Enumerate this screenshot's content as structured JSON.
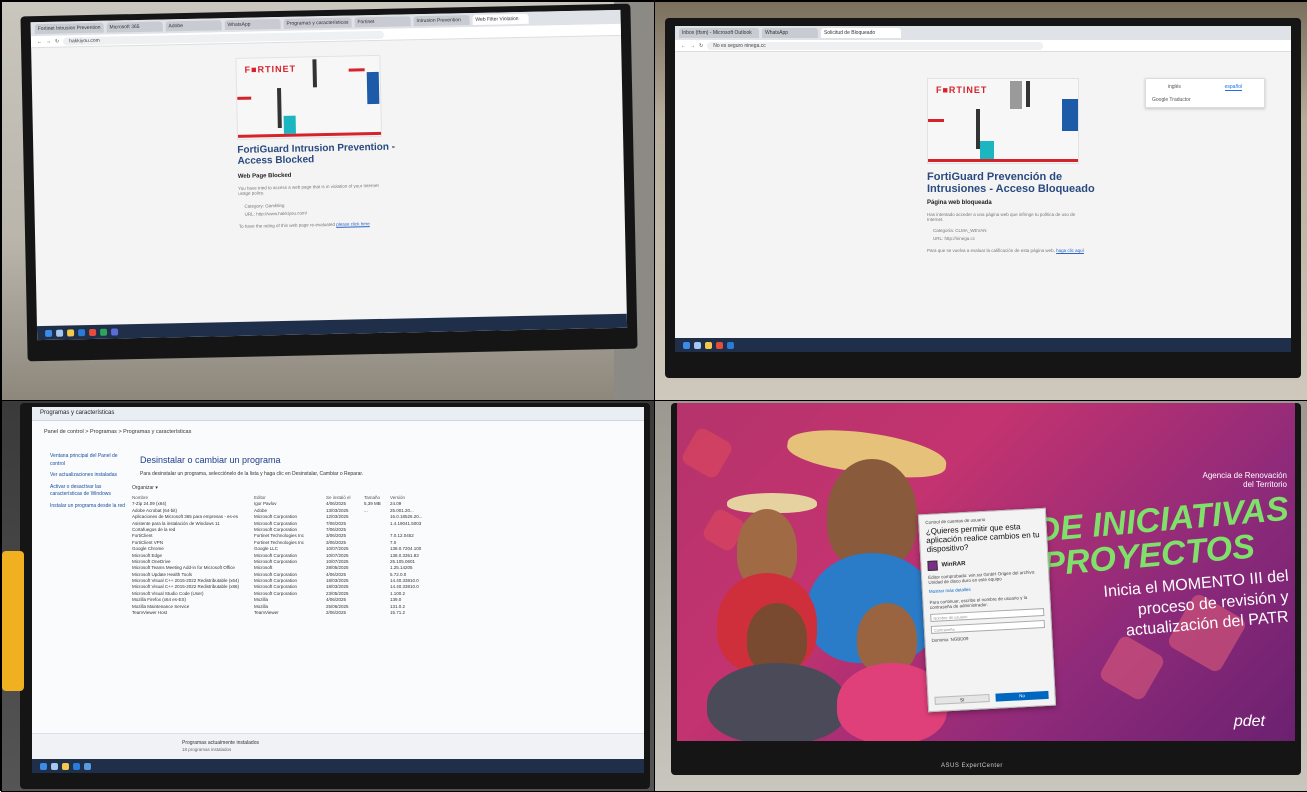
{
  "panel1": {
    "tabs": [
      "Fortinet Intrusion Prevention",
      "Microsoft 365",
      "Adobe",
      "WhatsApp",
      "Programas y características",
      "Fortinet",
      "Intrusion Prevention",
      "Web Filter Violation"
    ],
    "address": "hakkiyou.com",
    "brand": "F■RTINET",
    "title": "FortiGuard Intrusion Prevention - Access Blocked",
    "subtitle": "Web Page Blocked",
    "body": "You have tried to access a web page that is in violation of your Internet usage policy.",
    "category_label": "Category:",
    "category_value": "Gambling",
    "url_label": "URL:",
    "url_value": "http://www.hakkiyou.com/",
    "footer": "To have the rating of this web page re-evaluated",
    "footer_link": "please click here"
  },
  "panel2": {
    "tabs": [
      "Inbox (tfsm) - Microsoft Outlook",
      "WhatsApp",
      "Solicitud de Bloqueado"
    ],
    "address": "No es seguro  ninega.cc",
    "brand": "F■RTINET",
    "translate_options": [
      "inglés",
      "español"
    ],
    "translate_menu": "Google Traductor",
    "title": "FortiGuard Prevención de Intrusiones - Acceso Bloqueado",
    "subtitle": "Página web bloqueada",
    "body": "Has intentado acceder a una página web que infringe tu política de uso de Internet.",
    "category_label": "Categoría:",
    "category_value": "CLMA_WEVAN",
    "url_label": "URL:",
    "url_value": "http://ninega.cc",
    "footer": "Para que se vuelva a evaluar la calificación de esta página web,",
    "footer_link": "haga clic aquí"
  },
  "panel3": {
    "window_title": "Programas y características",
    "breadcrumb": "Panel de control  >  Programas  >  Programas y características",
    "sidebar": [
      "Ventana principal del Panel de control",
      "Ver actualizaciones instaladas",
      "Activar o desactivar las características de Windows",
      "Instalar un programa desde la red"
    ],
    "heading": "Desinstalar o cambiar un programa",
    "description": "Para desinstalar un programa, selecciónelo de la lista y haga clic en Desinstalar, Cambiar o Reparar.",
    "organize": "Organizar ▾",
    "columns": [
      "Nombre",
      "Editor",
      "Se instaló el",
      "Tamaño",
      "Versión"
    ],
    "rows": [
      [
        "7-Zip 24.09 (x64)",
        "Igor Pavlov",
        "4/06/2025",
        "5,39 MB",
        "24.09"
      ],
      [
        "Adobe Acrobat (64-bit)",
        "Adobe",
        "13/03/2025",
        "...",
        "25.001.20..."
      ],
      [
        "Aplicaciones de Microsoft 365 para empresas - es-es",
        "Microsoft Corporation",
        "12/03/2025",
        "",
        "16.0.18526.20..."
      ],
      [
        "Asistente para la instalación de Windows 11",
        "Microsoft Corporation",
        "7/06/2025",
        "",
        "1.4.19041.5003"
      ],
      [
        "Cortafuegos de la red",
        "Microsoft Corporation",
        "7/06/2025",
        "",
        ""
      ],
      [
        "FortiClient",
        "Fortinet Technologies Inc",
        "3/06/2025",
        "",
        "7.0.12.0452"
      ],
      [
        "FortiClient VPN",
        "Fortinet Technologies Inc",
        "3/06/2025",
        "",
        "7.0"
      ],
      [
        "Google Chrome",
        "Google LLC",
        "10/07/2025",
        "",
        "138.0.7204.100"
      ],
      [
        "Microsoft Edge",
        "Microsoft Corporation",
        "10/07/2025",
        "",
        "138.0.3351.83"
      ],
      [
        "Microsoft OneDrive",
        "Microsoft Corporation",
        "10/07/2025",
        "",
        "25.105.0601"
      ],
      [
        "Microsoft Teams Meeting Add-in for Microsoft Office",
        "Microsoft",
        "28/05/2025",
        "",
        "1.25.14205"
      ],
      [
        "Microsoft Update Health Tools",
        "Microsoft Corporation",
        "4/06/2025",
        "",
        "5.72.0.0"
      ],
      [
        "Microsoft Visual C++ 2015-2022 Redistributable (x64)",
        "Microsoft Corporation",
        "18/03/2025",
        "",
        "14.40.33810.0"
      ],
      [
        "Microsoft Visual C++ 2015-2022 Redistributable (x86)",
        "Microsoft Corporation",
        "18/03/2025",
        "",
        "14.40.33810.0"
      ],
      [
        "Microsoft Visual Studio Code (User)",
        "Microsoft Corporation",
        "23/05/2025",
        "",
        "1.100.2"
      ],
      [
        "Mozilla Firefox (x64 es-ES)",
        "Mozilla",
        "4/06/2025",
        "",
        "139.0"
      ],
      [
        "Mozilla Maintenance Service",
        "Mozilla",
        "25/06/2025",
        "",
        "131.0.2"
      ],
      [
        "TeamViewer Host",
        "TeamViewer",
        "2/06/2025",
        "",
        "15.71.2"
      ]
    ],
    "status_text": "Programas actualmente instalados",
    "status_count": "18 programas instalados"
  },
  "panel4": {
    "agency": "Agencia de Renovación del Territorio",
    "headline_1": "DE INICIATIVAS",
    "headline_2": "PROYECTOS",
    "subline_1": "Inicia el MOMENTO III del",
    "subline_2": "proceso de revisión y",
    "subline_3": "actualización del PATR",
    "uac": {
      "header": "Control de cuentas de usuario",
      "question": "¿Quieres permitir que esta aplicación realice cambios en tu dispositivo?",
      "app_name": "WinRAR",
      "info": "Editor comprobado: win.rar GmbH  Origen del archivo: Unidad de disco duro en este equipo",
      "more": "Mostrar más detalles",
      "instruction": "Para continuar, escribe el nombre de usuario y la contraseña de administrador.",
      "username_placeholder": "Nombre de usuario",
      "password_placeholder": "Contraseña",
      "domain": "Dominio: NGBD09",
      "yes": "Sí",
      "no": "No"
    },
    "monitor_brand": "ASUS ExpertCenter",
    "pdet_logo": "pdet"
  },
  "colors": {
    "fortinet_red": "#d5232b",
    "fortiguard_blue": "#2a4a7f",
    "banner_magenta": "#c3336f",
    "banner_green": "#7fe06a",
    "uac_blue": "#0067c0"
  }
}
